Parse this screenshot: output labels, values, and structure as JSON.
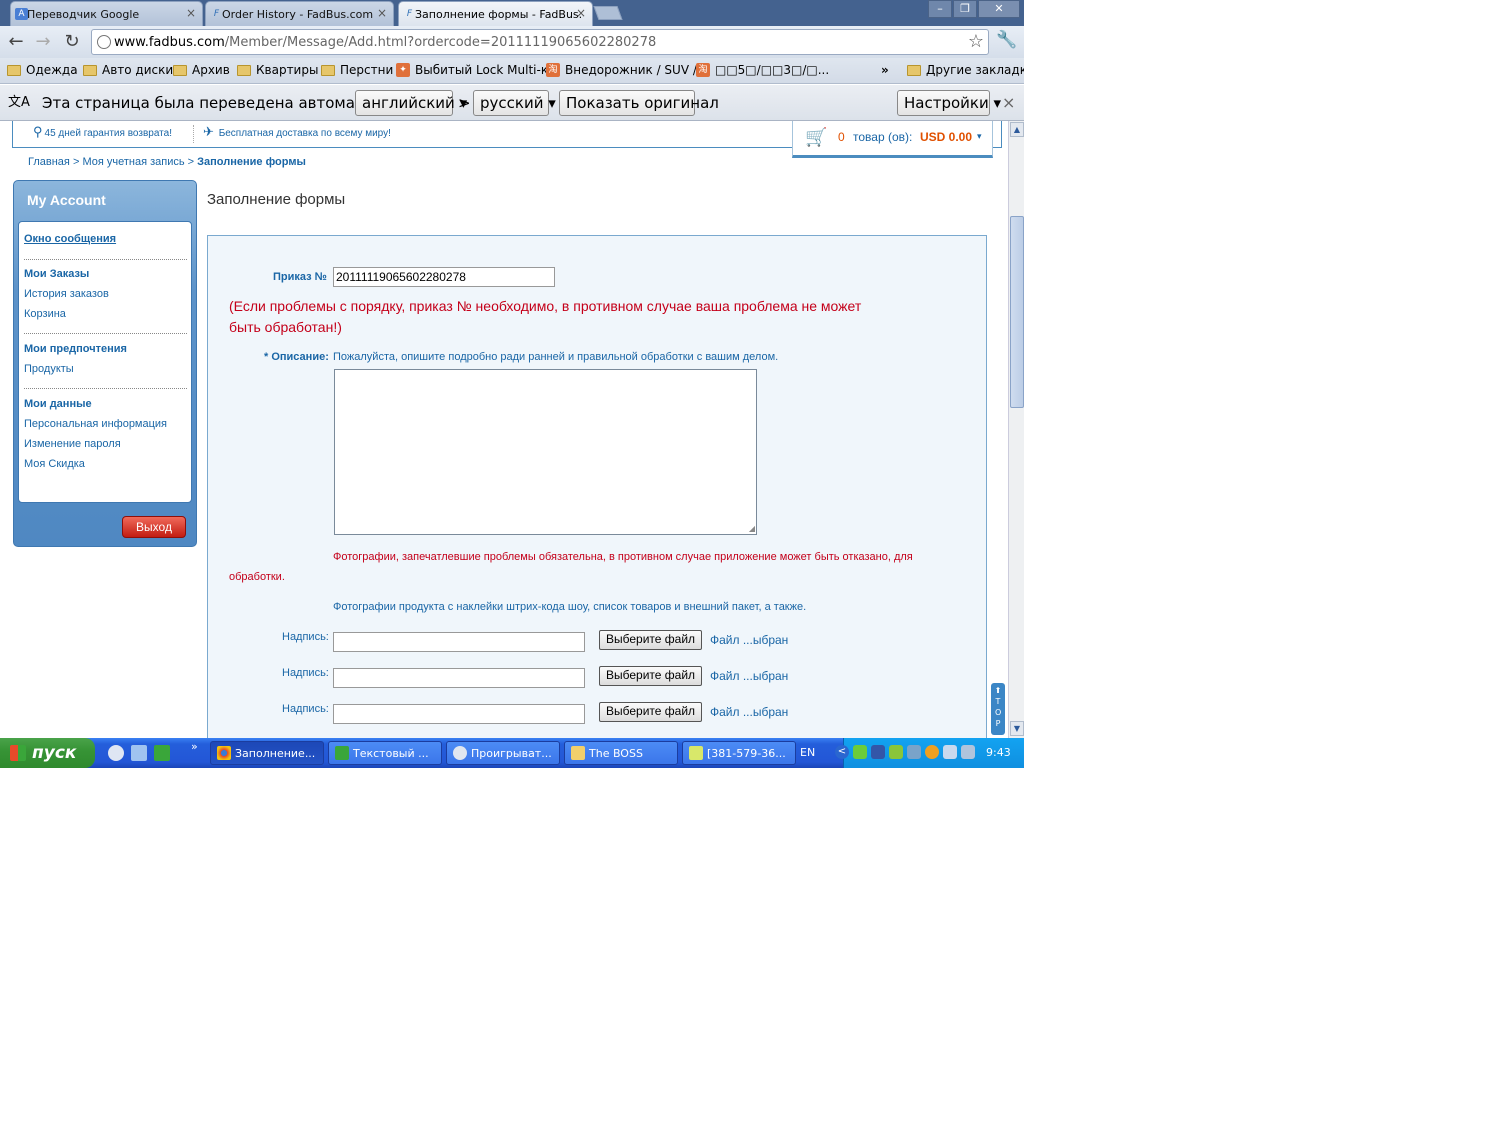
{
  "browser": {
    "tabs": [
      {
        "title": "Переводчик Google",
        "close": "×"
      },
      {
        "title": "Order History - FadBus.com",
        "close": "×"
      },
      {
        "title": "Заполнение формы - FadBus.",
        "close": "×"
      }
    ],
    "url_host": "www.fadbus.com",
    "url_path": "/Member/Message/Add.html?ordercode=20111119065602280278",
    "bookmarks": [
      "Одежда",
      "Авто диски",
      "Архив",
      "Квартиры",
      "Перстни",
      "Выбитый Lock Multi-к...",
      "Внедорожник / SUV /...",
      "□□5□/□□3□/□...",
      "Другие закладки"
    ],
    "bookmarks_more": "»"
  },
  "translate_bar": {
    "message": "Эта страница была переведена автоматически",
    "from_lang": "английский",
    "arrow": ">",
    "to_lang": "русский",
    "show_original": "Показать оригинал",
    "settings": "Настройки",
    "close": "×"
  },
  "site": {
    "promo_1": "45 дней гарантия возврата!",
    "promo_2": "Бесплатная доставка по всему миру!",
    "cart_count": "0",
    "cart_label": "товар (ов):",
    "cart_amount": "USD 0.00",
    "breadcrumb": {
      "home": "Главная",
      "sep": ">",
      "account": "Моя учетная запись",
      "current": "Заполнение формы"
    }
  },
  "sidebar": {
    "title": "My Account",
    "message_window": "Окно сообщения",
    "orders_head": "Мои Заказы",
    "order_history": "История заказов",
    "cart": "Корзина",
    "prefs_head": "Мои предпочтения",
    "products": "Продукты",
    "data_head": "Мои данные",
    "personal_info": "Персональная информация",
    "change_password": "Изменение пароля",
    "my_discount": "Моя Скидка",
    "logout": "Выход"
  },
  "form": {
    "page_title": "Заполнение формы",
    "order_label": "Приказ №",
    "order_value": "20111119065602280278",
    "order_warning_1": "(Если проблемы с порядку, приказ № необходимо, в противном случае ваша проблема не может",
    "order_warning_2": "быть обработан!)",
    "desc_label": "* Описание:",
    "desc_hint": "Пожалуйста, опишите подробно ради ранней и правильной обработки с вашим делом.",
    "photo_warning_1": "Фотографии, запечатлевшие проблемы обязательна, в противном случае приложение может быть отказано, для",
    "photo_warning_2": "обработки.",
    "photo_note": "Фотографии продукта с наклейки штрих-кода шоу, список товаров и внешний пакет, а также.",
    "caption_label": "Надпись:",
    "choose_file": "Выберите файл",
    "no_file": "Файл ...ыбран"
  },
  "top_button": "TOP",
  "taskbar": {
    "start": "пуск",
    "tasks": [
      "Заполнение...",
      "Текстовый ...",
      "Проигрыват...",
      "The BOSS",
      "[381-579-36..."
    ],
    "quick_more": "»",
    "lang": "EN",
    "clock": "9:43"
  }
}
